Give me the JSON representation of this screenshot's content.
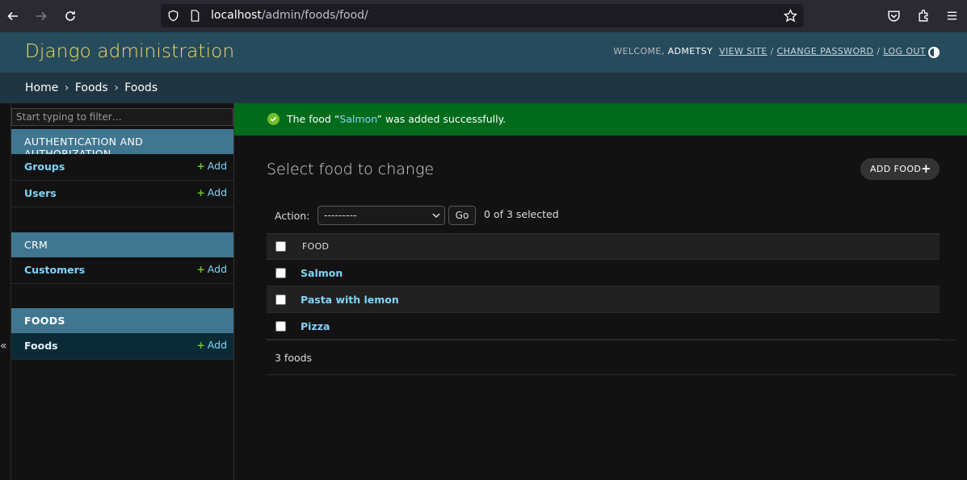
{
  "browser": {
    "url_host": "localhost",
    "url_path": "/admin/foods/food/"
  },
  "header": {
    "site_name": "Django administration",
    "welcome": "WELCOME,",
    "username": "ADMETSY",
    "view_site": "VIEW SITE",
    "change_password": "CHANGE PASSWORD",
    "log_out": "LOG OUT",
    "separator": "/"
  },
  "breadcrumbs": {
    "items": [
      "Home",
      "Foods",
      "Foods"
    ],
    "separator": "›"
  },
  "sidebar": {
    "filter_placeholder": "Start typing to filter…",
    "collapse_glyph": "«",
    "modules": [
      {
        "caption": "AUTHENTICATION AND AUTHORIZATION",
        "models": [
          {
            "name": "Groups",
            "add": "Add"
          },
          {
            "name": "Users",
            "add": "Add"
          }
        ]
      },
      {
        "caption": "CRM",
        "models": [
          {
            "name": "Customers",
            "add": "Add"
          }
        ]
      },
      {
        "caption": "FOODS",
        "models": [
          {
            "name": "Foods",
            "add": "Add",
            "current": true
          }
        ]
      }
    ]
  },
  "message": {
    "prefix": "The food “",
    "object": "Salmon",
    "suffix": "” was added successfully."
  },
  "main": {
    "title": "Select food to change",
    "add_button": "ADD FOOD",
    "add_plus": "+",
    "action_label": "Action:",
    "action_selected": "---------",
    "go_label": "Go",
    "counter": "0 of 3 selected",
    "column_header": "FOOD",
    "rows": [
      "Salmon",
      "Pasta with lemon",
      "Pizza"
    ],
    "paginator": "3 foods"
  },
  "colors": {
    "header_bg": "#264b5d",
    "site_name": "#f5dd5d",
    "module_caption": "#417690",
    "success_bg": "#006b1b",
    "link": "#81d4fa",
    "add_plus": "#70bf2b"
  }
}
